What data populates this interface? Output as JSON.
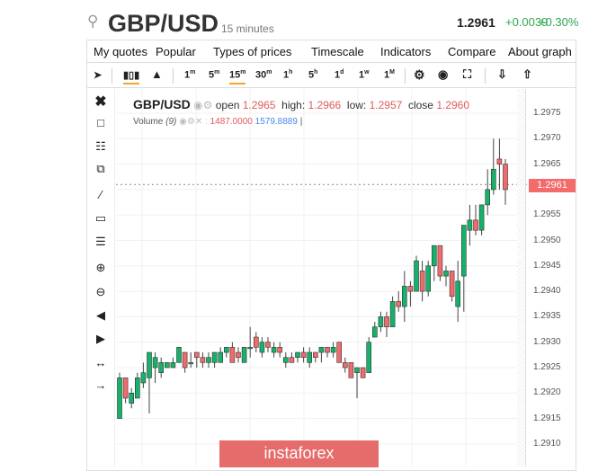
{
  "header": {
    "search_icon": "magnifier-icon",
    "symbol": "GBP/USD",
    "timeframe": "15 minutes",
    "price": "1.2961",
    "change": "+0.0039",
    "change_pct": "+0.30%",
    "up_color": "#2fa84f"
  },
  "menu": [
    "My quotes",
    "Popular",
    "Types of prices",
    "Timescale",
    "Indicators",
    "Compare",
    "About graph"
  ],
  "toolbar": {
    "timeframes": [
      "1m",
      "5m",
      "15m",
      "30m",
      "1h",
      "5h",
      "1d",
      "1w",
      "1M"
    ],
    "selected": "15m"
  },
  "legend": {
    "symbol": "GBP/USD",
    "open_label": "open",
    "open": "1.2965",
    "high_label": "high:",
    "high": "1.2966",
    "low_label": "low:",
    "low": "1.2957",
    "close_label": "close",
    "close": "1.2960",
    "volume_label": "Volume",
    "volume_period": "(9)",
    "volume_value": "1487.0000",
    "volume_ma": "1579.8889",
    "sep": ":"
  },
  "axis": {
    "ticks": [
      "1.2975",
      "1.2970",
      "1.2965",
      "1.2960",
      "1.2955",
      "1.2950",
      "1.2945",
      "1.2940",
      "1.2935",
      "1.2930",
      "1.2925",
      "1.2920",
      "1.2915",
      "1.2910"
    ],
    "current": "1.2961"
  },
  "watermark": "instaforex",
  "chart_data": {
    "type": "candlestick",
    "ylim": [
      1.2905,
      1.2978
    ],
    "current_price": 1.2961,
    "up_color": "#16b16a",
    "down_color": "#f06b6b",
    "ohlc": [
      [
        1.2915,
        1.2924,
        1.2915,
        1.2923
      ],
      [
        1.2923,
        1.2923,
        1.2918,
        1.2919
      ],
      [
        1.2918,
        1.2921,
        1.2917,
        1.292
      ],
      [
        1.2919,
        1.2924,
        1.2919,
        1.2923
      ],
      [
        1.2922,
        1.2926,
        1.2921,
        1.2924
      ],
      [
        1.2923,
        1.2928,
        1.2916,
        1.2928
      ],
      [
        1.2925,
        1.2928,
        1.2922,
        1.2927
      ],
      [
        1.2924,
        1.2927,
        1.2923,
        1.2926
      ],
      [
        1.2925,
        1.2926,
        1.2925,
        1.2926
      ],
      [
        1.2925,
        1.2927,
        1.2925,
        1.2926
      ],
      [
        1.2926,
        1.2929,
        1.2926,
        1.2929
      ],
      [
        1.2928,
        1.2928,
        1.2924,
        1.2925
      ],
      [
        1.2926,
        1.2928,
        1.2925,
        1.2926
      ],
      [
        1.2928,
        1.2928,
        1.2925,
        1.2927
      ],
      [
        1.2927,
        1.2928,
        1.2925,
        1.2926
      ],
      [
        1.2926,
        1.2928,
        1.2925,
        1.2927
      ],
      [
        1.2926,
        1.2928,
        1.2925,
        1.2928
      ],
      [
        1.2926,
        1.2929,
        1.2926,
        1.2928
      ],
      [
        1.2928,
        1.2929,
        1.2927,
        1.2929
      ],
      [
        1.2929,
        1.293,
        1.2926,
        1.2926
      ],
      [
        1.2928,
        1.2929,
        1.2926,
        1.2927
      ],
      [
        1.2926,
        1.2929,
        1.2926,
        1.2929
      ],
      [
        1.2929,
        1.2933,
        1.2927,
        1.2929
      ],
      [
        1.2931,
        1.2932,
        1.2928,
        1.2929
      ],
      [
        1.2928,
        1.2931,
        1.2927,
        1.293
      ],
      [
        1.293,
        1.2931,
        1.2928,
        1.2929
      ],
      [
        1.2928,
        1.293,
        1.2927,
        1.2929
      ],
      [
        1.2929,
        1.293,
        1.2927,
        1.2928
      ],
      [
        1.2926,
        1.2928,
        1.2925,
        1.2927
      ],
      [
        1.2927,
        1.2928,
        1.2926,
        1.2926
      ],
      [
        1.2927,
        1.2928,
        1.2926,
        1.2928
      ],
      [
        1.2928,
        1.2929,
        1.2926,
        1.2927
      ],
      [
        1.2926,
        1.2929,
        1.2925,
        1.2928
      ],
      [
        1.2928,
        1.2928,
        1.2926,
        1.2927
      ],
      [
        1.2928,
        1.2929,
        1.2926,
        1.2929
      ],
      [
        1.2929,
        1.2929,
        1.2927,
        1.2928
      ],
      [
        1.2928,
        1.293,
        1.2927,
        1.2929
      ],
      [
        1.293,
        1.293,
        1.2926,
        1.2926
      ],
      [
        1.2926,
        1.2927,
        1.2924,
        1.2925
      ],
      [
        1.2926,
        1.2926,
        1.2923,
        1.2923
      ],
      [
        1.2924,
        1.2925,
        1.2919,
        1.2925
      ],
      [
        1.2925,
        1.2925,
        1.2923,
        1.2923
      ],
      [
        1.2924,
        1.2931,
        1.2924,
        1.293
      ],
      [
        1.2931,
        1.2934,
        1.2931,
        1.2933
      ],
      [
        1.2933,
        1.2936,
        1.2932,
        1.2935
      ],
      [
        1.2935,
        1.2936,
        1.2931,
        1.2933
      ],
      [
        1.2933,
        1.2939,
        1.2933,
        1.2938
      ],
      [
        1.2938,
        1.294,
        1.2936,
        1.2937
      ],
      [
        1.2937,
        1.2944,
        1.2934,
        1.2941
      ],
      [
        1.2941,
        1.2942,
        1.2937,
        1.294
      ],
      [
        1.294,
        1.2947,
        1.294,
        1.2946
      ],
      [
        1.2944,
        1.2946,
        1.2938,
        1.294
      ],
      [
        1.294,
        1.2946,
        1.2939,
        1.2945
      ],
      [
        1.2945,
        1.2949,
        1.2942,
        1.2949
      ],
      [
        1.2949,
        1.2949,
        1.2942,
        1.2943
      ],
      [
        1.2943,
        1.2945,
        1.2941,
        1.2944
      ],
      [
        1.2944,
        1.2944,
        1.2938,
        1.2939
      ],
      [
        1.2937,
        1.2946,
        1.2934,
        1.2942
      ],
      [
        1.2943,
        1.2953,
        1.2936,
        1.2953
      ],
      [
        1.2952,
        1.2957,
        1.2949,
        1.2954
      ],
      [
        1.2954,
        1.2957,
        1.2951,
        1.2952
      ],
      [
        1.2952,
        1.2957,
        1.2951,
        1.2957
      ],
      [
        1.2957,
        1.2964,
        1.2955,
        1.296
      ],
      [
        1.296,
        1.297,
        1.2959,
        1.2964
      ],
      [
        1.2966,
        1.297,
        1.296,
        1.2965
      ],
      [
        1.2965,
        1.2966,
        1.2957,
        1.296
      ]
    ]
  }
}
